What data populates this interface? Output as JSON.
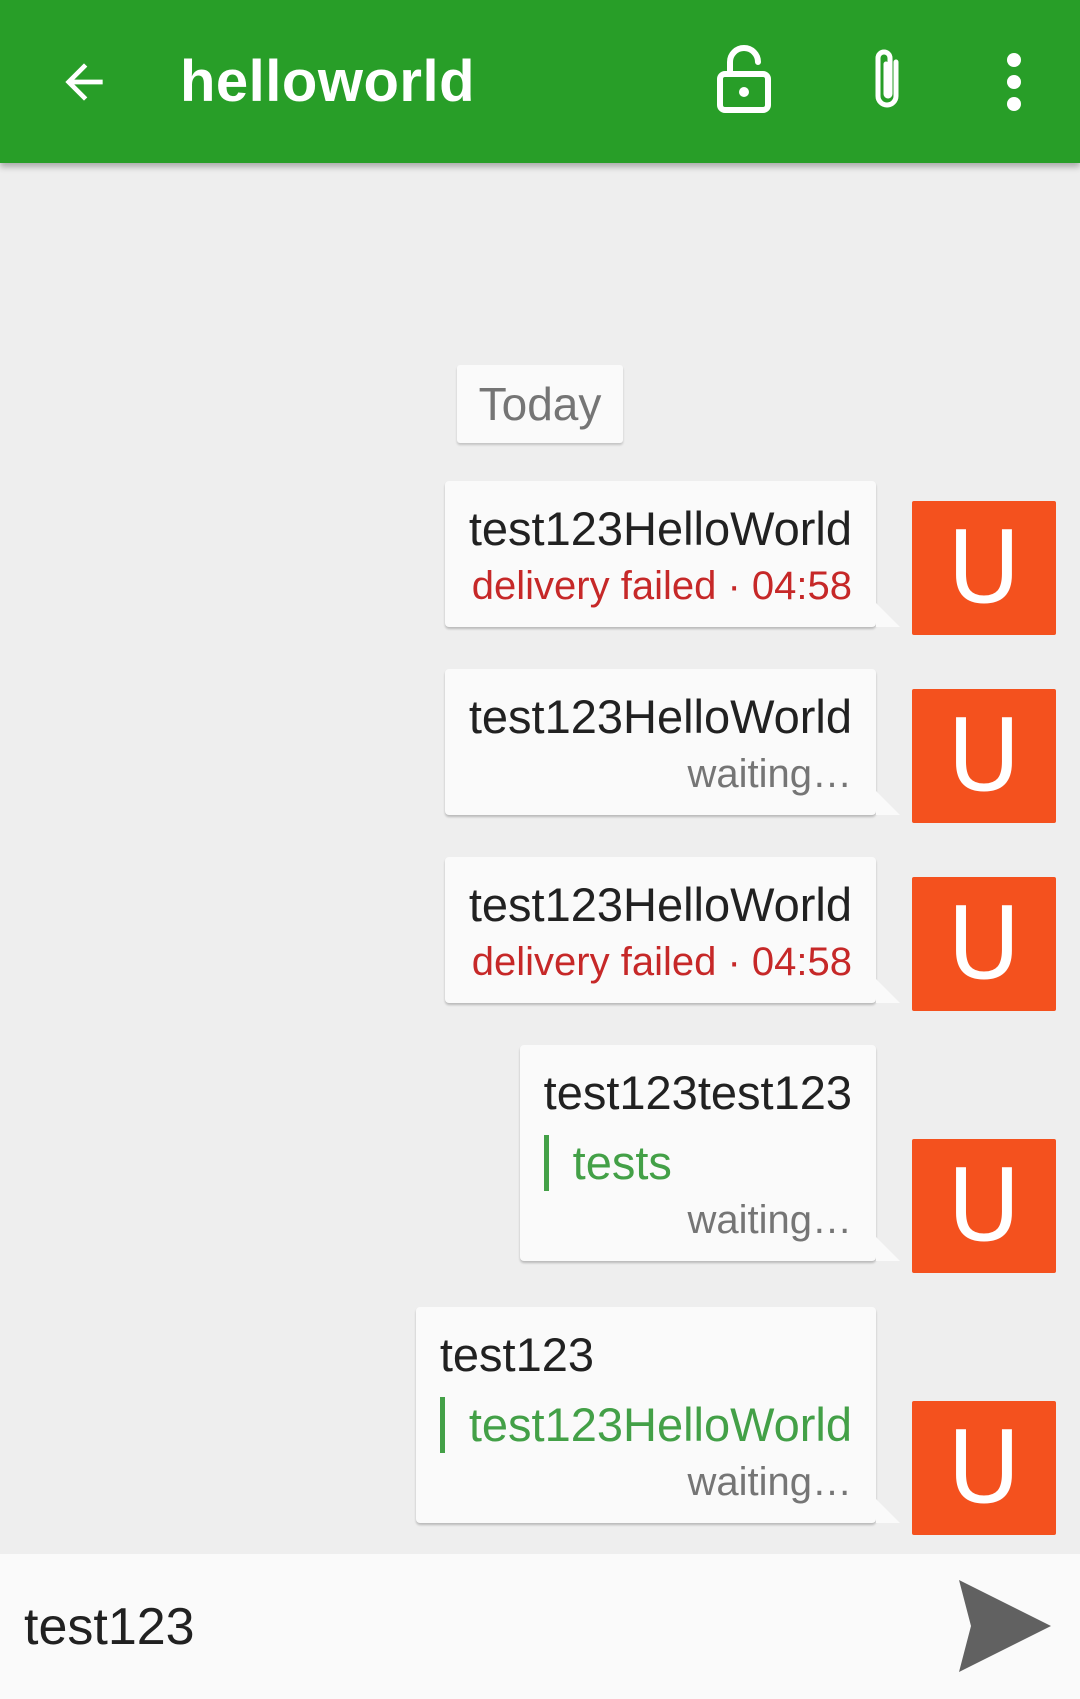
{
  "app_bar": {
    "title": "helloworld",
    "icons": [
      "back-arrow-icon",
      "lock-open-icon",
      "paperclip-icon",
      "more-vert-icon"
    ]
  },
  "chat": {
    "date_label": "Today",
    "messages": [
      {
        "text": "test123HelloWorld",
        "status": "delivery failed · 04:58",
        "status_type": "failed",
        "avatar": "U"
      },
      {
        "text": "test123HelloWorld",
        "status": "waiting…",
        "status_type": "waiting",
        "avatar": "U"
      },
      {
        "text": "test123HelloWorld",
        "status": "delivery failed · 04:58",
        "status_type": "failed",
        "avatar": "U"
      },
      {
        "text": "test123test123",
        "quote": "tests",
        "status": "waiting…",
        "status_type": "waiting",
        "avatar": "U"
      },
      {
        "text": "test123",
        "quote": "test123HelloWorld",
        "status": "waiting…",
        "status_type": "waiting",
        "avatar": "U"
      }
    ]
  },
  "composer": {
    "value": "test123",
    "send_icon": "send-icon"
  },
  "colors": {
    "app_bar": "#289e28",
    "avatar": "#f4511e",
    "failed": "#c62828",
    "quote": "#43a047",
    "background": "#eeeeee"
  }
}
